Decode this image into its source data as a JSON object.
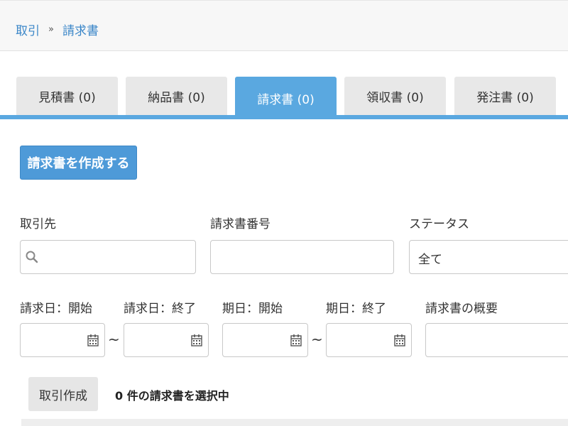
{
  "breadcrumb": {
    "parent": "取引",
    "separator": "»",
    "current": "請求書"
  },
  "tabs": [
    {
      "label": "見積書 (0)",
      "active": false
    },
    {
      "label": "納品書 (0)",
      "active": false
    },
    {
      "label": "請求書 (0)",
      "active": true
    },
    {
      "label": "領収書 (0)",
      "active": false
    },
    {
      "label": "発注書 (0)",
      "active": false
    }
  ],
  "create_button": {
    "label": "請求書を作成する"
  },
  "filters": {
    "partner": {
      "label": "取引先",
      "value": "",
      "icon": "search-icon"
    },
    "invoice_number": {
      "label": "請求書番号",
      "value": ""
    },
    "status": {
      "label": "ステータス",
      "value": "全て"
    },
    "invoice_date_start": {
      "label": "請求日：開始",
      "value": "",
      "icon": "calendar-icon"
    },
    "invoice_date_end": {
      "label": "請求日：終了",
      "value": "",
      "icon": "calendar-icon"
    },
    "due_date_start": {
      "label": "期日：開始",
      "value": "",
      "icon": "calendar-icon"
    },
    "due_date_end": {
      "label": "期日：終了",
      "value": "",
      "icon": "calendar-icon"
    },
    "summary": {
      "label": "請求書の概要",
      "value": ""
    },
    "range_separator": "~"
  },
  "actions": {
    "create_transaction": "取引作成",
    "selected_text": "0 件の請求書を選択中"
  },
  "colors": {
    "accent": "#5aa8e0",
    "button_blue": "#4e9ad8",
    "link": "#3a86c8"
  }
}
